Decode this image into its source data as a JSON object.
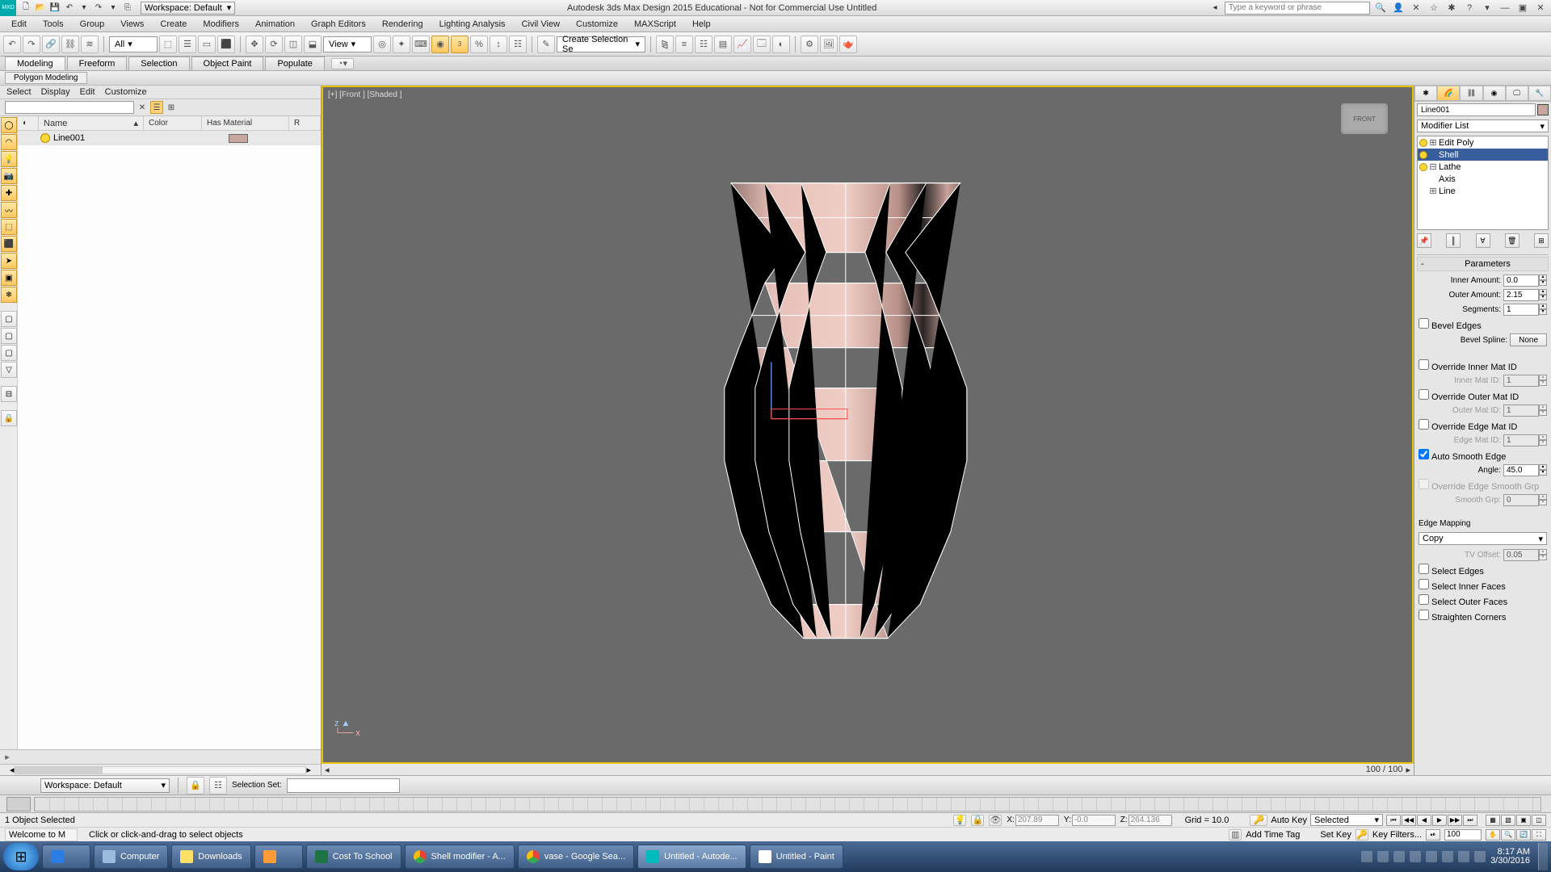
{
  "title": "Autodesk 3ds Max Design 2015  Educational - Not for Commercial Use   Untitled",
  "workspace_selector": "Workspace: Default",
  "search_placeholder": "Type a keyword or phrase",
  "menus": [
    "Edit",
    "Tools",
    "Group",
    "Views",
    "Create",
    "Modifiers",
    "Animation",
    "Graph Editors",
    "Rendering",
    "Lighting Analysis",
    "Civil View",
    "Customize",
    "MAXScript",
    "Help"
  ],
  "toolbar": {
    "all": "All",
    "view": "View",
    "create_sel": "Create Selection Se"
  },
  "ribbon_tabs": [
    "Modeling",
    "Freeform",
    "Selection",
    "Object Paint",
    "Populate"
  ],
  "sub_ribbon": "Polygon Modeling",
  "explorer": {
    "top_menu": [
      "Select",
      "Display",
      "Edit",
      "Customize"
    ],
    "cols": {
      "name": "Name",
      "color": "Color",
      "hasmat": "Has Material",
      "r": "R"
    },
    "row_name": "Line001"
  },
  "viewport": {
    "label": "[+] [Front ] [Shaded ]",
    "pager": "100 / 100",
    "cube": "FRONT"
  },
  "command_panel": {
    "object_name": "Line001",
    "modifier_list": "Modifier List",
    "stack": {
      "edit_poly": "Edit Poly",
      "shell": "Shell",
      "lathe": "Lathe",
      "axis": "Axis",
      "line": "Line"
    },
    "rollout_title": "Parameters",
    "inner_amount_lbl": "Inner Amount:",
    "inner_amount": "0.0",
    "outer_amount_lbl": "Outer Amount:",
    "outer_amount": "2.15",
    "segments_lbl": "Segments:",
    "segments": "1",
    "bevel_edges": "Bevel Edges",
    "bevel_spline_lbl": "Bevel Spline:",
    "bevel_spline_btn": "None",
    "ovr_inner": "Override Inner Mat ID",
    "inner_matid_lbl": "Inner Mat ID:",
    "inner_matid": "1",
    "ovr_outer": "Override Outer Mat ID",
    "outer_matid_lbl": "Outer Mat ID:",
    "outer_matid": "1",
    "ovr_edge": "Override Edge Mat ID",
    "edge_matid_lbl": "Edge Mat ID:",
    "edge_matid": "1",
    "auto_smooth": "Auto Smooth Edge",
    "angle_lbl": "Angle:",
    "angle": "45.0",
    "ovr_smooth_grp": "Override Edge Smooth Grp",
    "smooth_grp_lbl": "Smooth Grp:",
    "smooth_grp": "0",
    "edge_mapping_lbl": "Edge Mapping",
    "edge_mapping": "Copy",
    "tv_offset_lbl": "TV Offset:",
    "tv_offset": "0.05",
    "sel_edges": "Select Edges",
    "sel_inner": "Select Inner Faces",
    "sel_outer": "Select Outer Faces",
    "straighten": "Straighten Corners"
  },
  "ws_bar": {
    "workspace": "Workspace: Default",
    "selset_lbl": "Selection Set:"
  },
  "status1": {
    "sel": "1 Object Selected",
    "x_lbl": "X:",
    "x": "207.89",
    "y_lbl": "Y:",
    "y": "-0.0",
    "z_lbl": "Z:",
    "z": "264.136",
    "grid": "Grid = 10.0",
    "autokey_lbl": "Auto Key",
    "autokey_mode": "Selected"
  },
  "status2": {
    "welcome": "Welcome to M",
    "hint": "Click or click-and-drag to select objects",
    "add_tag": "Add Time Tag",
    "setkey": "Set Key",
    "keyfilters": "Key Filters...",
    "frame": "100"
  },
  "taskbar": {
    "items": [
      "Computer",
      "Downloads",
      "",
      "Cost To School",
      "Shell modifier - A...",
      "vase - Google Sea...",
      "Untitled - Autode...",
      "Untitled - Paint"
    ],
    "time": "8:17 AM",
    "date": "3/30/2016"
  }
}
